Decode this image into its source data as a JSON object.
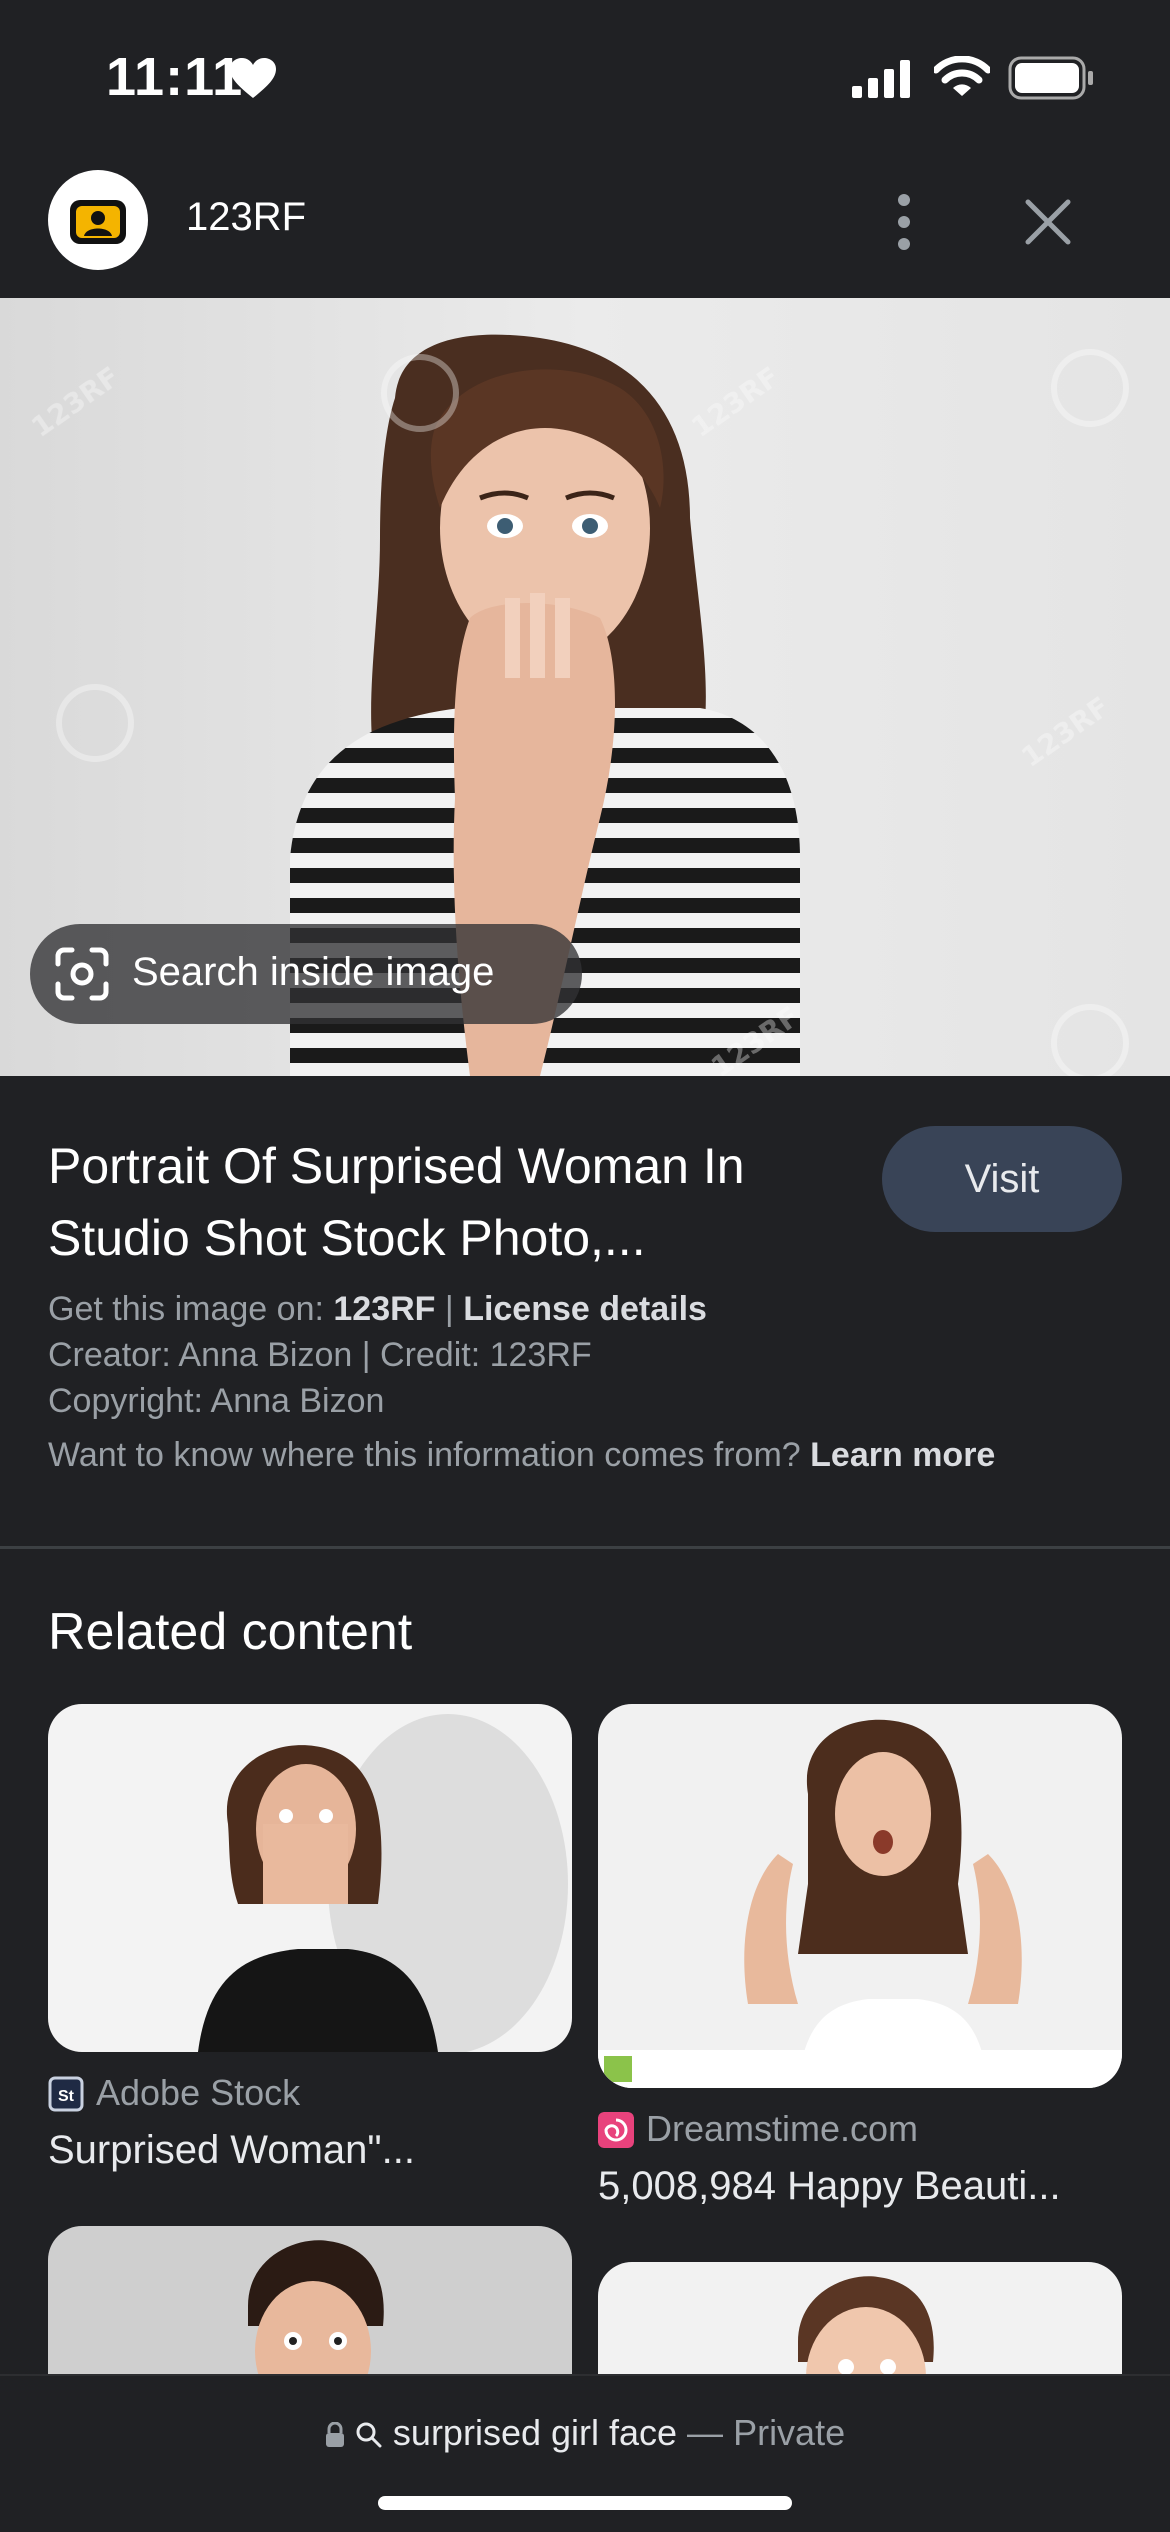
{
  "status_bar": {
    "time": "11:11",
    "icons": [
      "heart-icon",
      "signal-icon",
      "wifi-icon",
      "battery-icon"
    ]
  },
  "header": {
    "site_name": "123RF",
    "icons": [
      "camera-logo-icon",
      "more-vert-icon",
      "close-icon"
    ]
  },
  "hero": {
    "search_inside_label": "Search inside image",
    "watermark": "123RF"
  },
  "result": {
    "title": "Portrait Of Surprised Woman In Studio Shot Stock Photo,...",
    "visit_label": "Visit",
    "get_image_prefix": "Get this image on:",
    "get_image_source": "123RF",
    "separator": "|",
    "license_link": "License details",
    "creator_line": "Creator: Anna Bizon | Credit: 123RF",
    "copyright_line": "Copyright: Anna Bizon",
    "info_question": "Want to know where this information comes from?",
    "learn_more": "Learn more"
  },
  "related": {
    "title": "Related content",
    "items": [
      {
        "source": "Adobe Stock",
        "title": "Surprised Woman\"..."
      },
      {
        "source": "Dreamstime.com",
        "title": "5,008,984 Happy Beauti..."
      }
    ]
  },
  "bottom_bar": {
    "query": "surprised girl face",
    "separator": " — ",
    "mode": "Private"
  },
  "colors": {
    "background": "#202124",
    "visit_button": "#394457",
    "muted_text": "#9aa0a6"
  }
}
